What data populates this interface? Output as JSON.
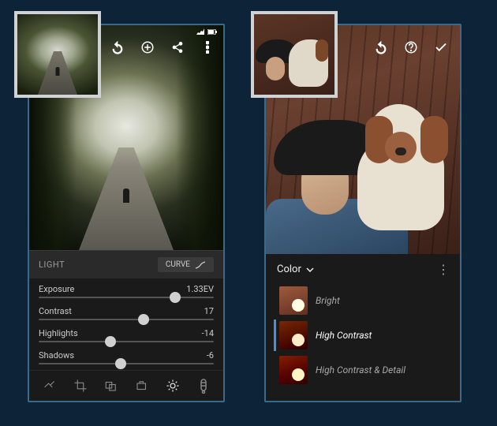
{
  "left": {
    "section_label": "LIGHT",
    "curve_label": "CURVE",
    "sliders": [
      {
        "name": "Exposure",
        "value": "1.33EV",
        "pos": 78
      },
      {
        "name": "Contrast",
        "value": "17",
        "pos": 60
      },
      {
        "name": "Highlights",
        "value": "-14",
        "pos": 41
      },
      {
        "name": "Shadows",
        "value": "-6",
        "pos": 47
      }
    ]
  },
  "right": {
    "group_label": "Color",
    "presets": [
      {
        "name": "Bright",
        "selected": false
      },
      {
        "name": "High Contrast",
        "selected": true
      },
      {
        "name": "High Contrast & Detail",
        "selected": false
      }
    ]
  }
}
